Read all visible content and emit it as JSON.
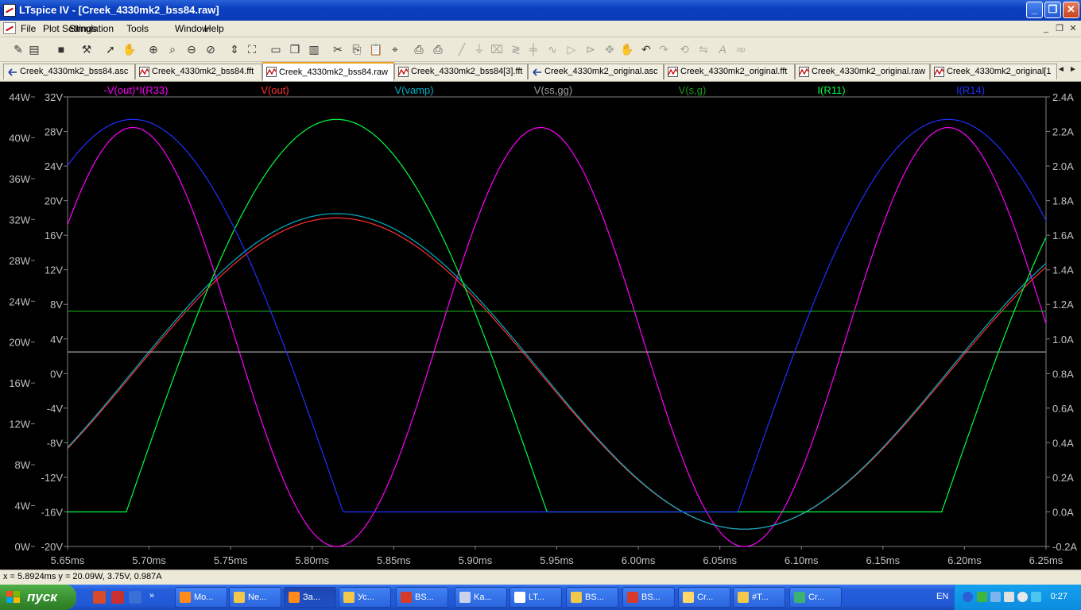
{
  "window": {
    "title": "LTspice IV - [Creek_4330mk2_bss84.raw]",
    "controls": [
      "_",
      "❐",
      "✕"
    ]
  },
  "menu": {
    "items": [
      "File",
      "Plot Settings",
      "Simulation",
      "Tools",
      "Window",
      "Help"
    ],
    "mdi_controls": [
      "_",
      "❐",
      "✕"
    ]
  },
  "toolbar": {
    "icons": [
      "new-schematic-icon",
      "open-icon",
      "save-icon",
      "control-panel-icon",
      "run-icon",
      "halt-icon",
      "zoom-in-icon",
      "zoom-area-icon",
      "zoom-out-icon",
      "zoom-cancel-icon",
      "autorange-icon",
      "zoom-extents-icon",
      "tile-horizontal-icon",
      "cascade-icon",
      "tile-vertical-icon",
      "cut-icon",
      "copy-icon",
      "paste-icon",
      "find-icon",
      "print-preview-icon",
      "print-icon",
      "wire-icon",
      "ground-icon",
      "label-icon",
      "resistor-icon",
      "capacitor-icon",
      "inductor-icon",
      "diode-icon",
      "component-icon",
      "move-icon",
      "drag-icon",
      "undo-icon",
      "redo-icon",
      "rotate-icon",
      "mirror-icon",
      "text-icon",
      "spice-directive-icon"
    ]
  },
  "tabs": [
    {
      "label": "Creek_4330mk2_bss84.asc",
      "kind": "schematic",
      "active": false
    },
    {
      "label": "Creek_4330mk2_bss84.fft",
      "kind": "waveform",
      "active": false
    },
    {
      "label": "Creek_4330mk2_bss84.raw",
      "kind": "waveform",
      "active": true
    },
    {
      "label": "Creek_4330mk2_bss84[3].fft",
      "kind": "waveform",
      "active": false
    },
    {
      "label": "Creek_4330mk2_original.asc",
      "kind": "schematic",
      "active": false
    },
    {
      "label": "Creek_4330mk2_original.fft",
      "kind": "waveform",
      "active": false
    },
    {
      "label": "Creek_4330mk2_original.raw",
      "kind": "waveform",
      "active": false
    },
    {
      "label": "Creek_4330mk2_original[1",
      "kind": "waveform",
      "active": false
    }
  ],
  "tab_scroll": [
    "◄",
    "►"
  ],
  "chart_data": {
    "type": "line",
    "background": "#000000",
    "x_unit": "ms",
    "xlim": [
      5.65,
      6.25
    ],
    "x_ticks": [
      "5.65ms",
      "5.70ms",
      "5.75ms",
      "5.80ms",
      "5.85ms",
      "5.90ms",
      "5.95ms",
      "6.00ms",
      "6.05ms",
      "6.10ms",
      "6.15ms",
      "6.20ms",
      "6.25ms"
    ],
    "y_axes": [
      {
        "id": "watts",
        "unit": "W",
        "range": [
          0,
          44
        ],
        "ticks": [
          "0W",
          "4W",
          "8W",
          "12W",
          "16W",
          "20W",
          "24W",
          "28W",
          "32W",
          "36W",
          "40W",
          "44W"
        ]
      },
      {
        "id": "volts",
        "unit": "V",
        "range": [
          -20,
          32
        ],
        "ticks": [
          "-20V",
          "-16V",
          "-12V",
          "-8V",
          "-4V",
          "0V",
          "4V",
          "8V",
          "12V",
          "16V",
          "20V",
          "24V",
          "28V",
          "32V"
        ]
      },
      {
        "id": "amps",
        "unit": "A",
        "range": [
          -0.2,
          2.4
        ],
        "ticks": [
          "-0.2A",
          "0.0A",
          "0.2A",
          "0.4A",
          "0.6A",
          "0.8A",
          "1.0A",
          "1.2A",
          "1.4A",
          "1.6A",
          "1.8A",
          "2.0A",
          "2.2A",
          "2.4A"
        ]
      }
    ],
    "grid": false,
    "legend_placement": "top",
    "series": [
      {
        "name": "-V(out)*I(R33)",
        "color": "#ff00ff",
        "axis": "watts",
        "shape": "sine2",
        "peak_x": 5.69,
        "min": 0,
        "max": 41,
        "period": 0.25
      },
      {
        "name": "V(out)",
        "color": "#ff3030",
        "axis": "volts",
        "shape": "sine",
        "peak_x": 5.815,
        "min": -18,
        "max": 18,
        "period": 0.5
      },
      {
        "name": "V(vamp)",
        "color": "#00b0c8",
        "axis": "volts",
        "shape": "sine",
        "peak_x": 5.815,
        "min": -18,
        "max": 18.5,
        "period": 0.5
      },
      {
        "name": "V(ss,gg)",
        "color": "#a0a0a0",
        "axis": "volts",
        "shape": "const",
        "value": 2.5
      },
      {
        "name": "V(s,g)",
        "color": "#1e9a1e",
        "axis": "volts",
        "shape": "const",
        "value": 7.2
      },
      {
        "name": "I(R11)",
        "color": "#00ff40",
        "axis": "amps",
        "shape": "halfwave",
        "peak_x": 5.815,
        "base": 0.0,
        "max": 2.27,
        "period": 0.5
      },
      {
        "name": "I(R14)",
        "color": "#2030ff",
        "axis": "amps",
        "shape": "halfwave",
        "peak_x": 5.69,
        "base": 0.0,
        "max": 2.27,
        "period": 0.5
      }
    ]
  },
  "status": {
    "cursor_readout": "x = 5.8924ms    y = 20.09W, 3.75V, 0.987A"
  },
  "taskbar": {
    "start_label": "пуск",
    "tasks": [
      {
        "label": "Mo...",
        "color": "#ff8a1a",
        "active": false
      },
      {
        "label": "Ne...",
        "color": "#f2c84b",
        "active": false
      },
      {
        "label": "За...",
        "color": "#ff8a1a",
        "active": true
      },
      {
        "label": "Ус...",
        "color": "#f2c84b",
        "active": false
      },
      {
        "label": "BS...",
        "color": "#d83a2a",
        "active": false
      },
      {
        "label": "Ka...",
        "color": "#c9d2e8",
        "active": false
      },
      {
        "label": "LT...",
        "color": "#ffffff",
        "active": false
      },
      {
        "label": "BS...",
        "color": "#f2c84b",
        "active": false
      },
      {
        "label": "BS...",
        "color": "#d83a2a",
        "active": false
      },
      {
        "label": "Cr...",
        "color": "#ffd76a",
        "active": false
      },
      {
        "label": "#T...",
        "color": "#f2c84b",
        "active": false
      },
      {
        "label": "Cr...",
        "color": "#3cb371",
        "active": false
      }
    ],
    "language": "EN",
    "clock": "0:27"
  }
}
